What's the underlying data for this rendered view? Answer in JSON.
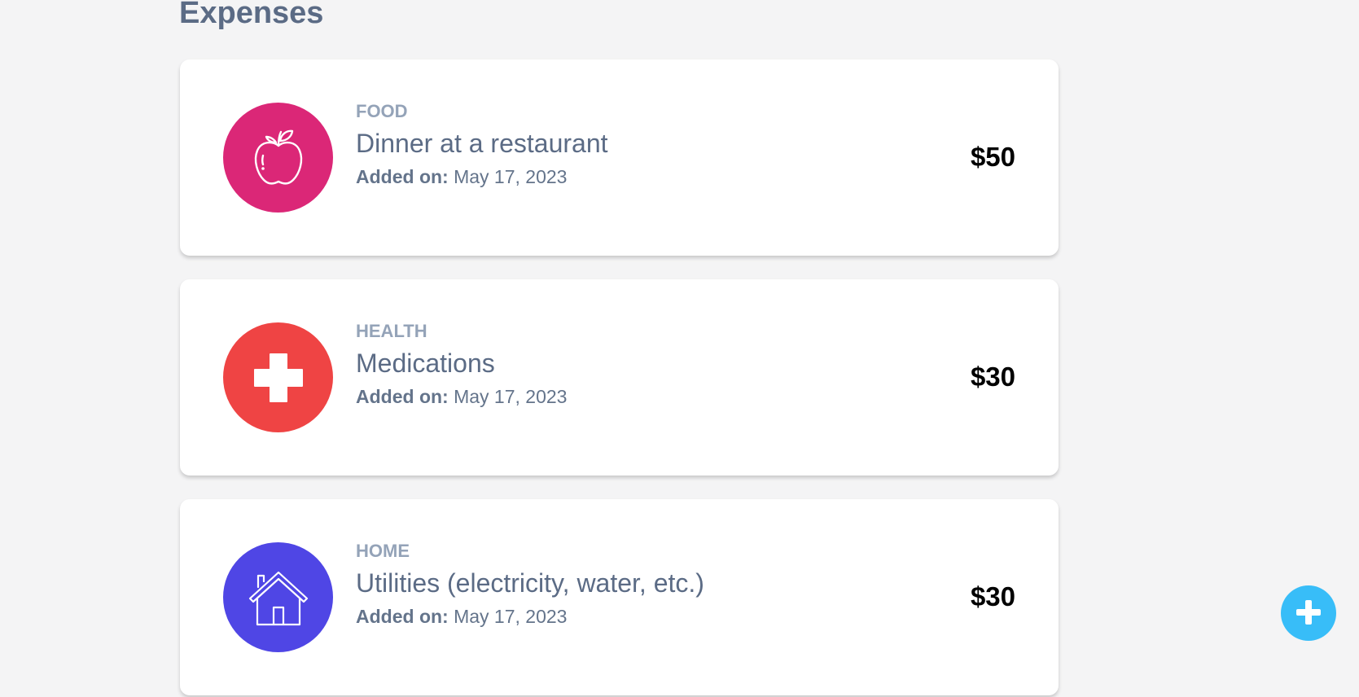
{
  "page": {
    "heading": "Expenses"
  },
  "expenses": [
    {
      "category": "FOOD",
      "title": "Dinner at a restaurant",
      "added_label": "Added on:",
      "date": "May 17, 2023",
      "amount": "$50",
      "icon": "apple-icon",
      "color": "#db2777"
    },
    {
      "category": "HEALTH",
      "title": "Medications",
      "added_label": "Added on:",
      "date": "May 17, 2023",
      "amount": "$30",
      "icon": "medical-cross-icon",
      "color": "#ef4444"
    },
    {
      "category": "HOME",
      "title": "Utilities (electricity, water, etc.)",
      "added_label": "Added on:",
      "date": "May 17, 2023",
      "amount": "$30",
      "icon": "house-icon",
      "color": "#4f46e5"
    }
  ],
  "fab": {
    "icon": "plus-icon",
    "color": "#38bdf8"
  }
}
